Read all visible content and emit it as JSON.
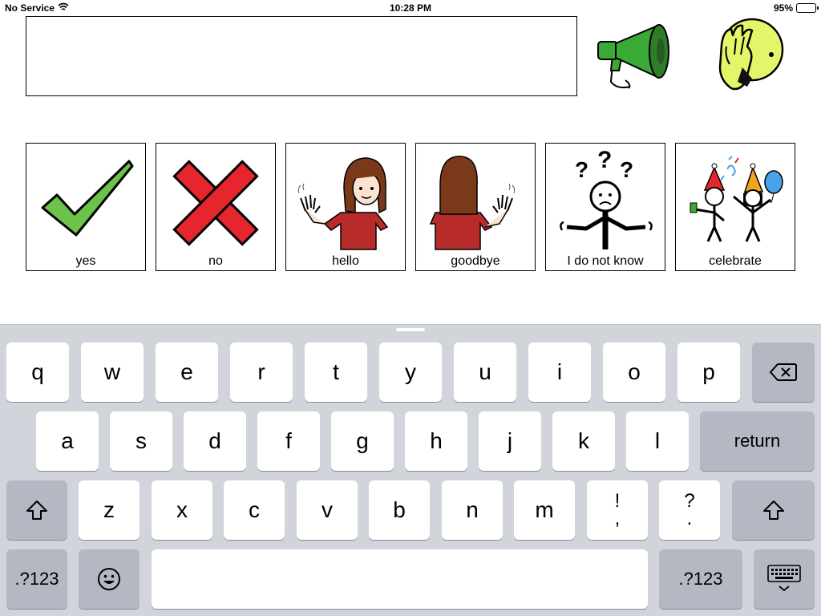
{
  "status_bar": {
    "carrier": "No Service",
    "time": "10:28 PM",
    "battery": "95%",
    "battery_level": 0.95
  },
  "message_bar": {
    "text": ""
  },
  "actions": {
    "speak_icon": "megaphone-icon",
    "clear_icon": "face-palm-icon"
  },
  "tiles": [
    {
      "label": "yes",
      "icon": "checkmark-icon"
    },
    {
      "label": "no",
      "icon": "cross-icon"
    },
    {
      "label": "hello",
      "icon": "girl-waving-icon"
    },
    {
      "label": "goodbye",
      "icon": "girl-waving-back-icon"
    },
    {
      "label": "I do not know",
      "icon": "shrug-person-icon"
    },
    {
      "label": "celebrate",
      "icon": "party-people-icon"
    }
  ],
  "keyboard": {
    "row1": [
      "q",
      "w",
      "e",
      "r",
      "t",
      "y",
      "u",
      "i",
      "o",
      "p"
    ],
    "row2": [
      "a",
      "s",
      "d",
      "f",
      "g",
      "h",
      "j",
      "k",
      "l"
    ],
    "row3": [
      "z",
      "x",
      "c",
      "v",
      "b",
      "n",
      "m"
    ],
    "punct1": {
      "top": "!",
      "bottom": ","
    },
    "punct2": {
      "top": "?",
      "bottom": "."
    },
    "return_label": "return",
    "numbers_label": ".?123",
    "icons": {
      "delete": "backspace-icon",
      "shift": "shift-icon",
      "emoji": "emoji-icon",
      "dismiss": "keyboard-dismiss-icon"
    }
  }
}
